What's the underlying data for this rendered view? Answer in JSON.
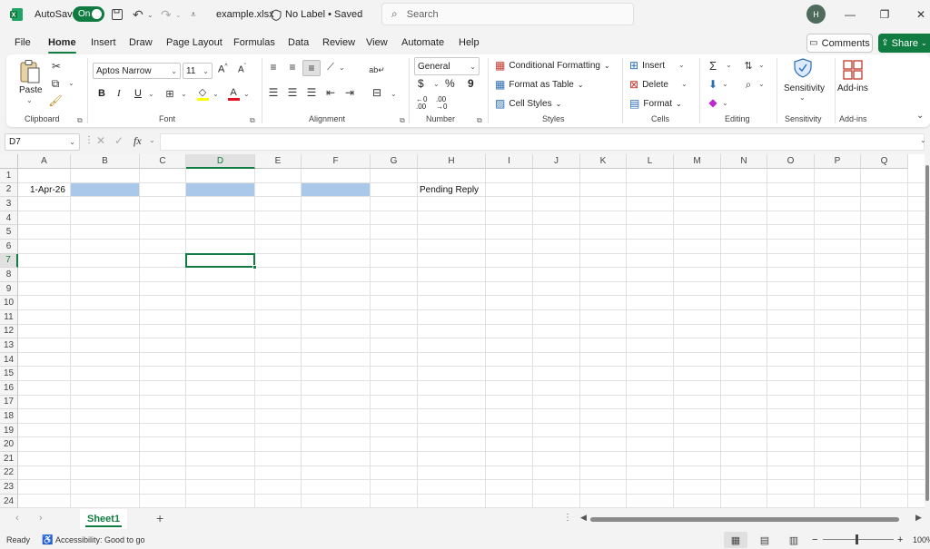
{
  "titlebar": {
    "autosave_label": "AutoSave",
    "autosave_state": "On",
    "filename": "example.xlsx",
    "sensitivity_status": "No Label • Saved",
    "search_placeholder": "Search",
    "user_initial": "H"
  },
  "menu": {
    "tabs": [
      "File",
      "Home",
      "Insert",
      "Draw",
      "Page Layout",
      "Formulas",
      "Data",
      "Review",
      "View",
      "Automate",
      "Help"
    ],
    "active": "Home",
    "comments": "Comments",
    "share": "Share"
  },
  "ribbon": {
    "clipboard": {
      "paste": "Paste",
      "label": "Clipboard"
    },
    "font": {
      "family": "Aptos Narrow",
      "size": "11",
      "bold": "B",
      "italic": "I",
      "underline": "U",
      "label": "Font"
    },
    "alignment": {
      "label": "Alignment"
    },
    "number": {
      "format": "General",
      "currency": "$",
      "percent": "%",
      "comma": "9",
      "label": "Number"
    },
    "styles": {
      "conditional": "Conditional Formatting",
      "table": "Format as Table",
      "cell_styles": "Cell Styles",
      "label": "Styles"
    },
    "cells": {
      "insert": "Insert",
      "delete": "Delete",
      "format": "Format",
      "label": "Cells"
    },
    "editing": {
      "label": "Editing"
    },
    "sensitivity": {
      "button": "Sensitivity",
      "label": "Sensitivity"
    },
    "addins": {
      "button": "Add-ins",
      "label": "Add-ins"
    }
  },
  "formula_bar": {
    "name_box": "D7",
    "fx": "fx",
    "content": ""
  },
  "grid": {
    "columns": [
      "A",
      "B",
      "C",
      "D",
      "E",
      "F",
      "G",
      "H",
      "I",
      "J",
      "K",
      "L",
      "M",
      "N",
      "O",
      "P",
      "Q"
    ],
    "rows": [
      "1",
      "2",
      "3",
      "4",
      "5",
      "6",
      "7",
      "8",
      "9",
      "10",
      "11",
      "12",
      "13",
      "14",
      "15",
      "16",
      "17",
      "18",
      "19",
      "20",
      "21",
      "22",
      "23",
      "24"
    ],
    "cells": {
      "A2": "1-Apr-26",
      "H2": "Pending Reply"
    },
    "selected_column": "D",
    "selected_row": "7",
    "fill_color": "#a9c8ea"
  },
  "sheets": {
    "tabs": [
      "Sheet1"
    ],
    "add": "+"
  },
  "status": {
    "ready": "Ready",
    "accessibility": "Accessibility: Good to go",
    "zoom": "100%"
  },
  "colors": {
    "accent": "#107c41"
  }
}
